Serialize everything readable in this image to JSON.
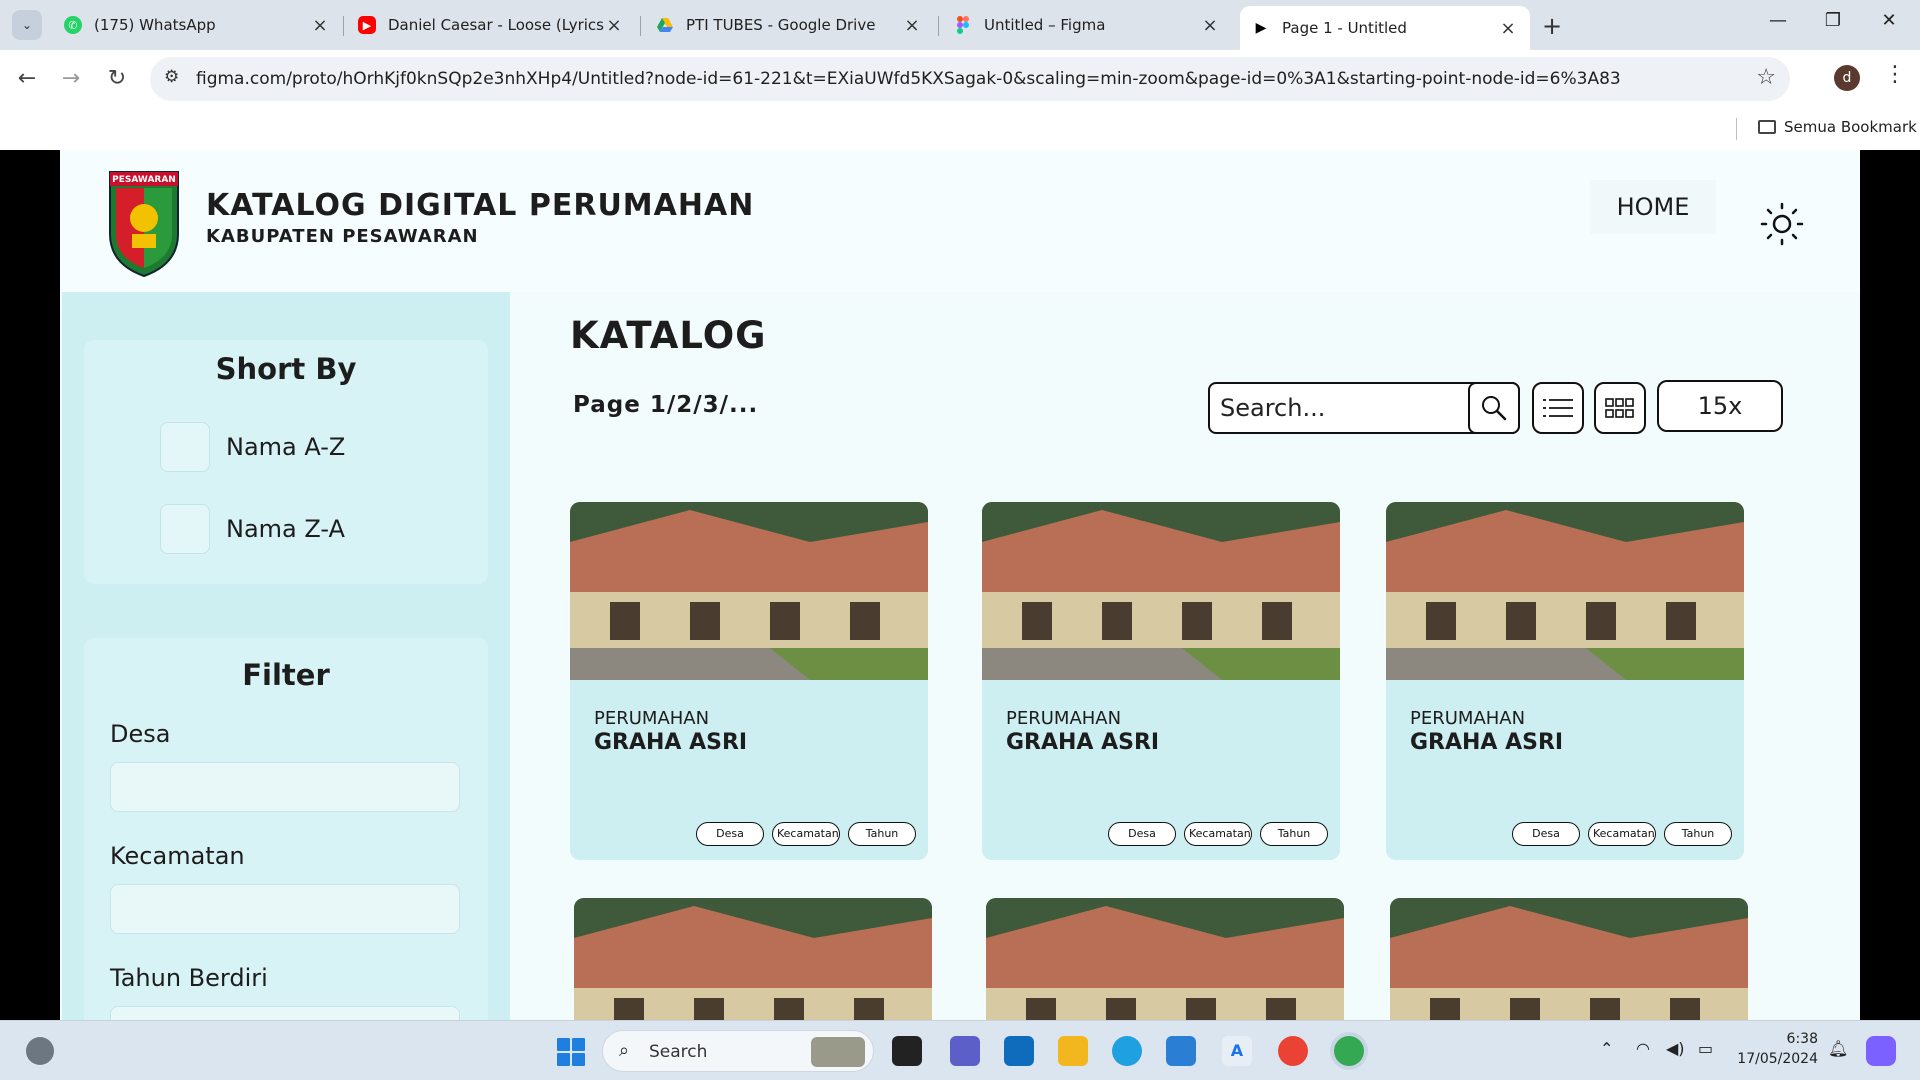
{
  "browser": {
    "tabs": [
      {
        "label": "(175) WhatsApp",
        "icon": "whatsapp-icon",
        "color": "#25d366"
      },
      {
        "label": "Daniel Caesar - Loose (Lyrics) -",
        "icon": "youtube-icon",
        "color": "#ff0000"
      },
      {
        "label": "PTI TUBES - Google Drive",
        "icon": "google-drive-icon",
        "color": "#1fa463"
      },
      {
        "label": "Untitled – Figma",
        "icon": "figma-icon",
        "color": "#a259ff"
      },
      {
        "label": "Page 1 - Untitled",
        "icon": "play-icon",
        "color": "#000000"
      }
    ],
    "url": "figma.com/proto/hOrhKjf0knSQp2e3nhXHp4/Untitled?node-id=61-221&t=EXiaUWfd5KXSagak-0&scaling=min-zoom&page-id=0%3A1&starting-point-node-id=6%3A83",
    "profile_initial": "d",
    "bookmark_all": "Semua Bookmark"
  },
  "site": {
    "logo_text": "PESAWARAN",
    "title": "KATALOG DIGITAL PERUMAHAN",
    "subtitle": "KABUPATEN PESAWARAN",
    "nav_home": "HOME"
  },
  "sidebar": {
    "sort_title": "Short By",
    "sort_options": [
      "Nama A-Z",
      "Nama Z-A"
    ],
    "filter_title": "Filter",
    "filters": [
      "Desa",
      "Kecamatan",
      "Tahun Berdiri"
    ]
  },
  "main": {
    "title": "KATALOG",
    "pager": "Page 1/2/3/...",
    "search_placeholder": "Search...",
    "per_page": "15x"
  },
  "cards": [
    {
      "type": "PERUMAHAN",
      "name": "GRAHA ASRI",
      "tags": [
        "Desa",
        "Kecamatan",
        "Tahun"
      ]
    },
    {
      "type": "PERUMAHAN",
      "name": "GRAHA ASRI",
      "tags": [
        "Desa",
        "Kecamatan",
        "Tahun"
      ]
    },
    {
      "type": "PERUMAHAN",
      "name": "GRAHA ASRI",
      "tags": [
        "Desa",
        "Kecamatan",
        "Tahun"
      ]
    }
  ],
  "taskbar": {
    "search_label": "Search",
    "time": "6:38",
    "date": "17/05/2024"
  },
  "colors": {
    "page_bg": "#f3fcfd",
    "sidebar_bg": "#cdeff2",
    "card_bg": "#cdeff2"
  }
}
